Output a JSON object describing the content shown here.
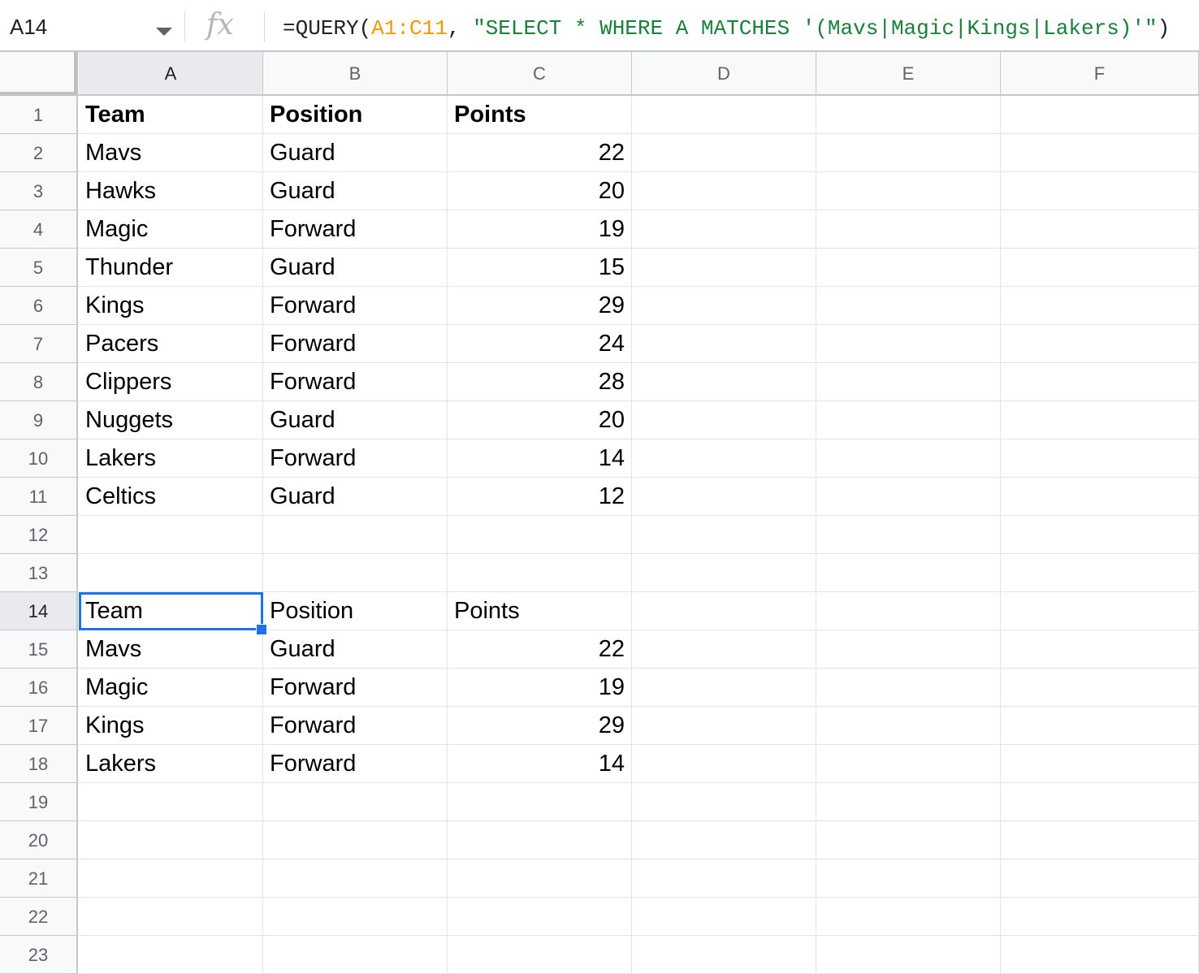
{
  "formula_bar": {
    "name_box": "A14",
    "fx_label": "fx",
    "formula_prefix": "=QUERY(",
    "formula_range": "A1:C11",
    "formula_sep": ", ",
    "formula_string": "\"SELECT * WHERE A MATCHES '(Mavs|Magic|Kings|Lakers)'\"",
    "formula_suffix": ")"
  },
  "columns": [
    "A",
    "B",
    "C",
    "D",
    "E",
    "F"
  ],
  "active_column": "A",
  "active_row": "14",
  "selected_cell": "A14",
  "rows": [
    {
      "n": "1",
      "cells": [
        "Team",
        "Position",
        "Points"
      ],
      "bold": true
    },
    {
      "n": "2",
      "cells": [
        "Mavs",
        "Guard",
        "22"
      ]
    },
    {
      "n": "3",
      "cells": [
        "Hawks",
        "Guard",
        "20"
      ]
    },
    {
      "n": "4",
      "cells": [
        "Magic",
        "Forward",
        "19"
      ]
    },
    {
      "n": "5",
      "cells": [
        "Thunder",
        "Guard",
        "15"
      ]
    },
    {
      "n": "6",
      "cells": [
        "Kings",
        "Forward",
        "29"
      ]
    },
    {
      "n": "7",
      "cells": [
        "Pacers",
        "Forward",
        "24"
      ]
    },
    {
      "n": "8",
      "cells": [
        "Clippers",
        "Forward",
        "28"
      ]
    },
    {
      "n": "9",
      "cells": [
        "Nuggets",
        "Guard",
        "20"
      ]
    },
    {
      "n": "10",
      "cells": [
        "Lakers",
        "Forward",
        "14"
      ]
    },
    {
      "n": "11",
      "cells": [
        "Celtics",
        "Guard",
        "12"
      ]
    },
    {
      "n": "12",
      "cells": [
        "",
        "",
        ""
      ]
    },
    {
      "n": "13",
      "cells": [
        "",
        "",
        ""
      ]
    },
    {
      "n": "14",
      "cells": [
        "Team",
        "Position",
        "Points"
      ]
    },
    {
      "n": "15",
      "cells": [
        "Mavs",
        "Guard",
        "22"
      ]
    },
    {
      "n": "16",
      "cells": [
        "Magic",
        "Forward",
        "19"
      ]
    },
    {
      "n": "17",
      "cells": [
        "Kings",
        "Forward",
        "29"
      ]
    },
    {
      "n": "18",
      "cells": [
        "Lakers",
        "Forward",
        "14"
      ]
    },
    {
      "n": "19",
      "cells": [
        "",
        "",
        ""
      ]
    },
    {
      "n": "20",
      "cells": [
        "",
        "",
        ""
      ]
    },
    {
      "n": "21",
      "cells": [
        "",
        "",
        ""
      ]
    },
    {
      "n": "22",
      "cells": [
        "",
        "",
        ""
      ]
    },
    {
      "n": "23",
      "cells": [
        "",
        "",
        ""
      ]
    }
  ],
  "colors": {
    "selection": "#1a73e8",
    "range_ref": "#f29900",
    "string_literal": "#188038"
  }
}
